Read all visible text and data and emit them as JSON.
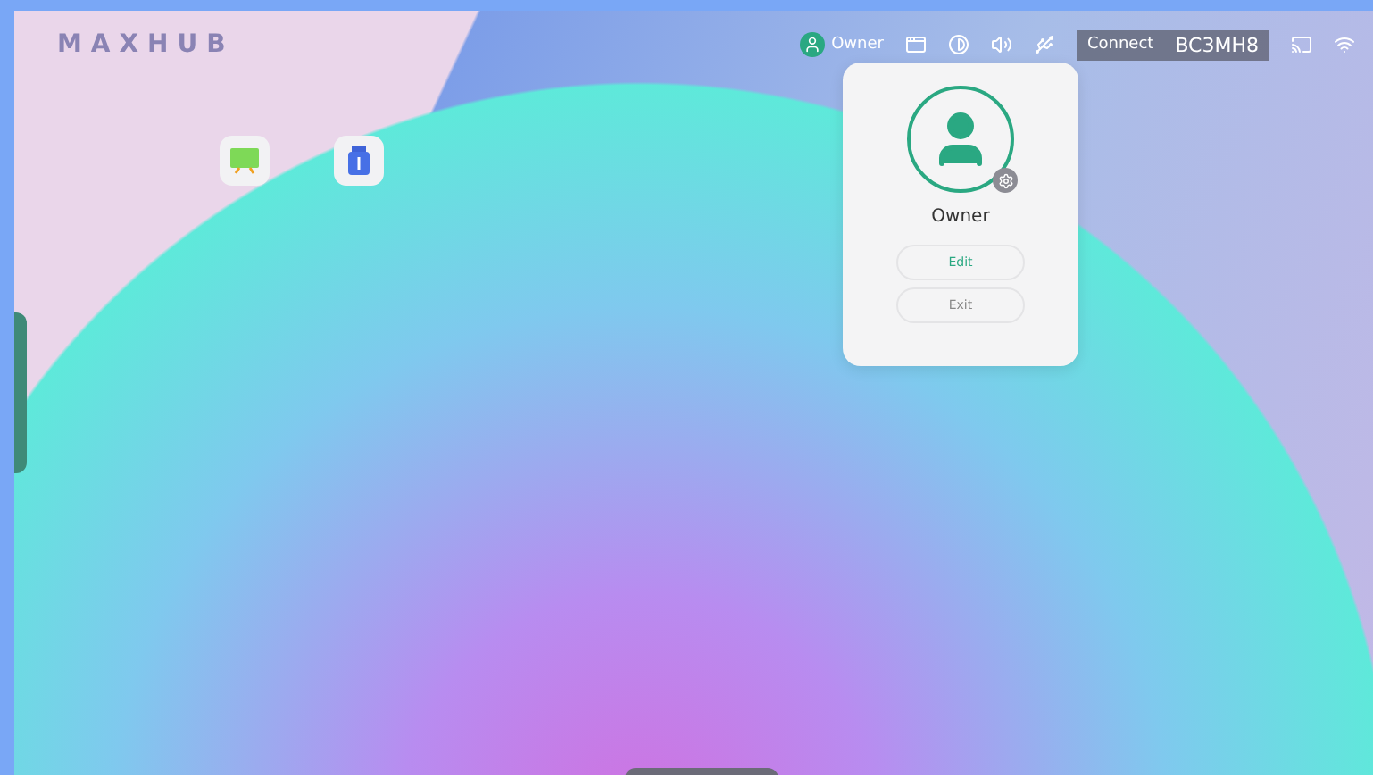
{
  "brand": "MAXHUB",
  "status_bar": {
    "user": "Owner",
    "connect": {
      "label": "Connect",
      "code": "BC3MH8"
    }
  },
  "desktop_apps": [
    {
      "kind": "board"
    },
    {
      "kind": "transfer"
    }
  ],
  "user_menu": {
    "name": "Owner",
    "buttons": [
      {
        "label": "Edit",
        "primary": true
      },
      {
        "label": "Exit",
        "primary": false
      }
    ]
  }
}
